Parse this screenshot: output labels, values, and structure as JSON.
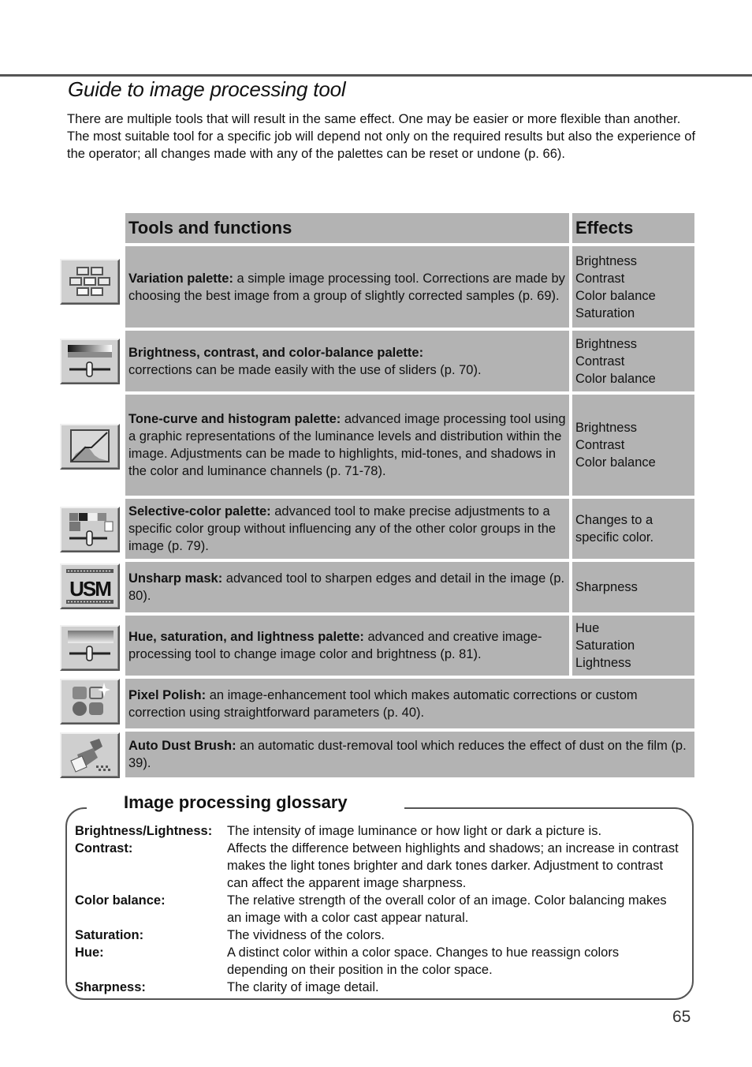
{
  "page": {
    "title": "Guide to image processing tool",
    "intro": "There are multiple tools that will result in the same effect. One may be easier or more flexible than another. The most suitable tool for a specific job will depend not only on the required results but also the experience of the operator; all changes made with any of the palettes can be reset or undone (p. 66).",
    "page_number": "65"
  },
  "table": {
    "headers": {
      "functions": "Tools and functions",
      "effects": "Effects"
    },
    "rows": [
      {
        "icon": "variation-palette-icon",
        "name": "Variation palette:",
        "desc": " a simple image processing tool. Corrections are made by choosing the best image from a group of slightly corrected samples (p. 69).",
        "effects": [
          "Brightness",
          "Contrast",
          "Color balance",
          "Saturation"
        ]
      },
      {
        "icon": "brightness-contrast-palette-icon",
        "name": "Brightness, contrast, and color-balance palette:",
        "desc": "corrections can be made easily with the use of sliders (p. 70).",
        "effects": [
          "Brightness",
          "Contrast",
          "Color balance"
        ]
      },
      {
        "icon": "tone-curve-histogram-icon",
        "name": "Tone-curve and histogram palette:",
        "desc": " advanced image processing tool using a graphic representations of the luminance levels and distribution within the image. Adjustments can be made to highlights, mid-tones, and shadows in the color and luminance channels (p. 71-78).",
        "effects": [
          "Brightness",
          "Contrast",
          "Color balance"
        ]
      },
      {
        "icon": "selective-color-palette-icon",
        "name": "Selective-color palette:",
        "desc": " advanced tool to make precise adjustments to a specific color group without influencing any of the other color groups in the image (p. 79).",
        "effects": [
          "Changes to a specific color."
        ]
      },
      {
        "icon": "unsharp-mask-icon",
        "name": "Unsharp mask:",
        "desc": " advanced tool to sharpen edges and detail in the image (p. 80).",
        "effects": [
          "Sharpness"
        ]
      },
      {
        "icon": "hue-saturation-lightness-icon",
        "name": "Hue, saturation, and lightness palette:",
        "desc": " advanced and creative image-processing tool to change image color and brightness (p. 81).",
        "effects": [
          "Hue",
          "Saturation",
          "Lightness"
        ]
      },
      {
        "icon": "pixel-polish-icon",
        "name": "Pixel Polish:",
        "desc": " an image-enhancement tool which makes automatic corrections or custom correction using straightforward parameters (p. 40).",
        "effects": []
      },
      {
        "icon": "auto-dust-brush-icon",
        "name": "Auto Dust Brush:",
        "desc": " an automatic dust-removal tool which reduces the effect of dust on the film (p. 39).",
        "effects": []
      }
    ]
  },
  "glossary": {
    "title": "Image processing glossary",
    "items": [
      {
        "term": "Brightness/Lightness:",
        "definition": "The intensity of image luminance or how light or dark a picture is."
      },
      {
        "term": "Contrast:",
        "definition": "Affects the difference between highlights and shadows; an increase in contrast makes the light tones brighter and dark tones darker. Adjustment to contrast can affect the apparent image sharpness."
      },
      {
        "term": "Color balance:",
        "definition": "The relative strength of the overall color of an image. Color balancing makes an image with a color cast appear natural."
      },
      {
        "term": "Saturation:",
        "definition": "The vividness of the colors."
      },
      {
        "term": "Hue:",
        "definition": "A distinct color within a color space. Changes to hue reassign colors depending on their position in the color space."
      },
      {
        "term": "Sharpness:",
        "definition": "The clarity of image detail."
      }
    ]
  }
}
